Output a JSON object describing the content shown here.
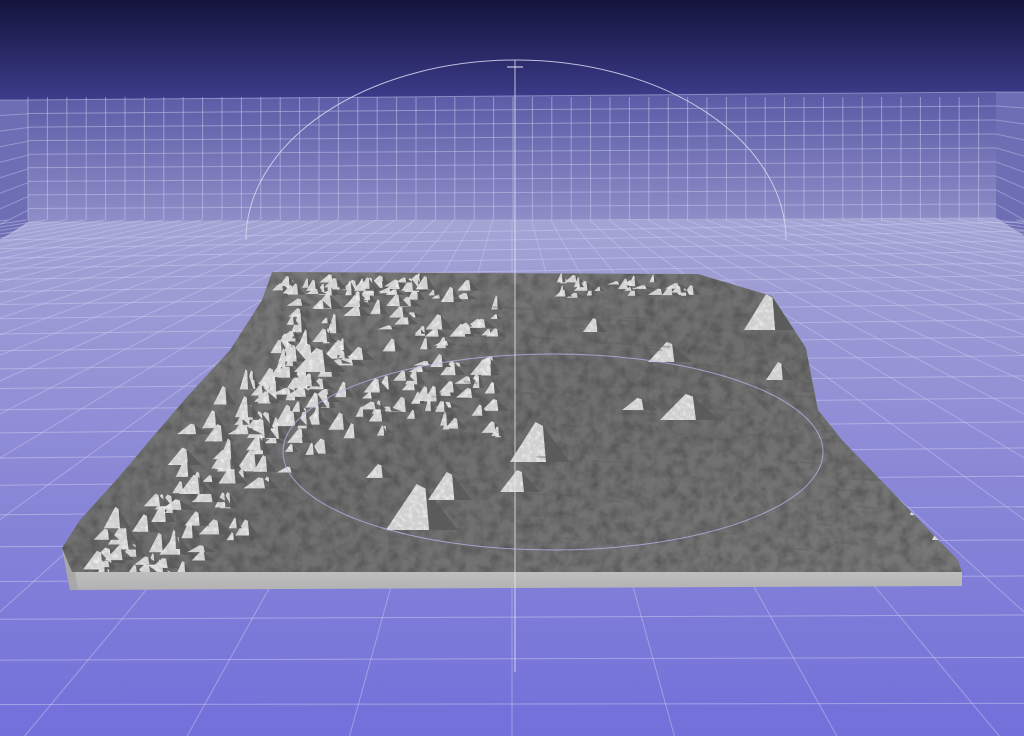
{
  "viewer": {
    "background_top": "#14143c",
    "background_horizon": "#4a4aa0",
    "floor_near": "#7a78d8",
    "floor_far": "#9c9cd6",
    "grid_line": "#c8c8ee",
    "trackball_color": "#d8d8f0",
    "terrain_color": "#8a8a8a",
    "terrain_shadow": "#4e4e4e",
    "terrain_highlight": "#d4d4d4",
    "base_color": "#c4c4c4"
  }
}
